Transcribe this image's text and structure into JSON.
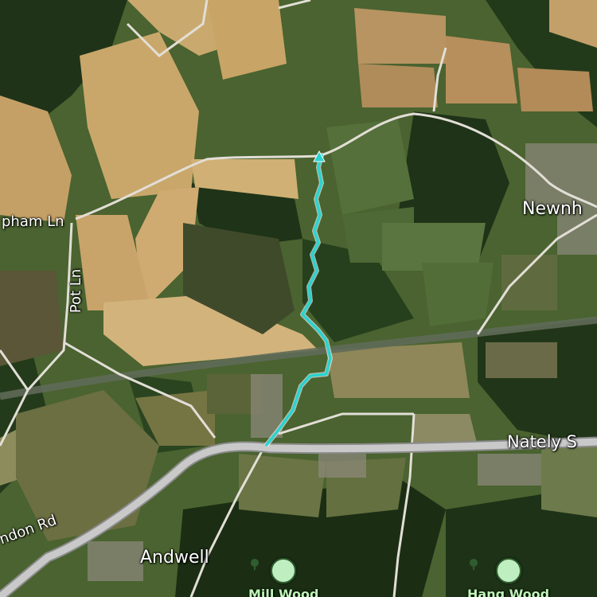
{
  "map": {
    "style": "satellite",
    "colors": {
      "route": "#29d3cf",
      "road_main": "#bdbdbd",
      "road_minor": "#e2ded6",
      "railway": "#6f6f6f",
      "poi_pin": "#bfeec0",
      "poi_label": "#bff5b8"
    }
  },
  "road_labels": [
    {
      "id": "newnham-ln",
      "text": "pham Ln"
    },
    {
      "id": "pot-ln",
      "text": "Pot Ln"
    },
    {
      "id": "nately-s",
      "text": "Nately S"
    },
    {
      "id": "london-rd",
      "text": "ndon Rd"
    }
  ],
  "place_labels": [
    {
      "id": "newnham",
      "text": "Newnh"
    },
    {
      "id": "andwell",
      "text": "Andwell"
    }
  ],
  "pois": [
    {
      "id": "mill-wood",
      "label": "Mill Wood",
      "icon": "tree-icon"
    },
    {
      "id": "hang-wood",
      "label": "Hang Wood",
      "icon": "tree-icon"
    }
  ],
  "route": {
    "color": "#29d3cf",
    "icon": "route-end-arrow-icon"
  }
}
